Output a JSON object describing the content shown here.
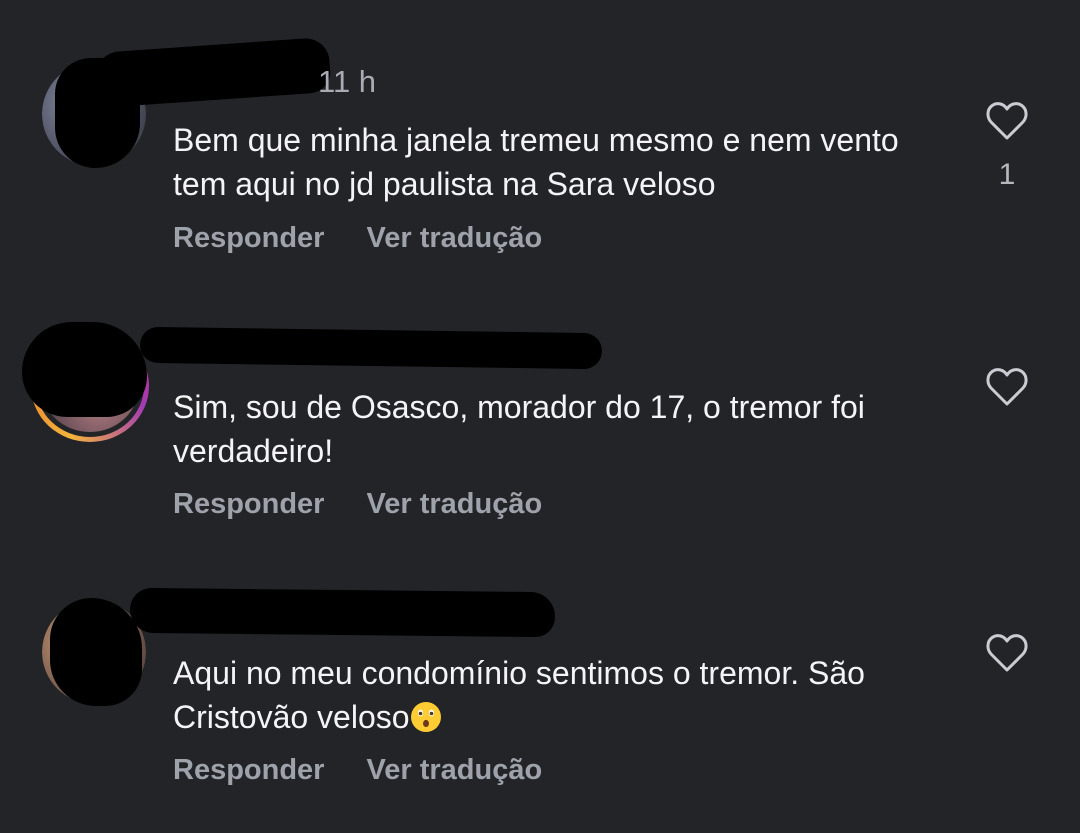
{
  "comments": [
    {
      "timestamp": "11 h",
      "text": "Bem que minha janela tremeu mesmo e nem vento tem aqui no jd paulista na Sara veloso",
      "reply_label": "Responder",
      "translate_label": "Ver tradução",
      "like_count": "1",
      "like_icon": "heart-outline-icon"
    },
    {
      "timestamp": "",
      "text": "Sim, sou de Osasco, morador do 17, o tremor foi verdadeiro!",
      "reply_label": "Responder",
      "translate_label": "Ver tradução",
      "like_icon": "heart-outline-icon"
    },
    {
      "timestamp": "",
      "text": "Aqui no meu condomínio sentimos o tremor. São Cristovão veloso",
      "emoji": "hushed-face-emoji",
      "reply_label": "Responder",
      "translate_label": "Ver tradução",
      "like_icon": "heart-outline-icon"
    }
  ],
  "colors": {
    "background": "#232428",
    "primary_text": "#f4f4f6",
    "secondary_text": "#9ea2ab",
    "story_ring": [
      "#f3b43c",
      "#e8782e",
      "#d62d72",
      "#a23bb5"
    ]
  }
}
